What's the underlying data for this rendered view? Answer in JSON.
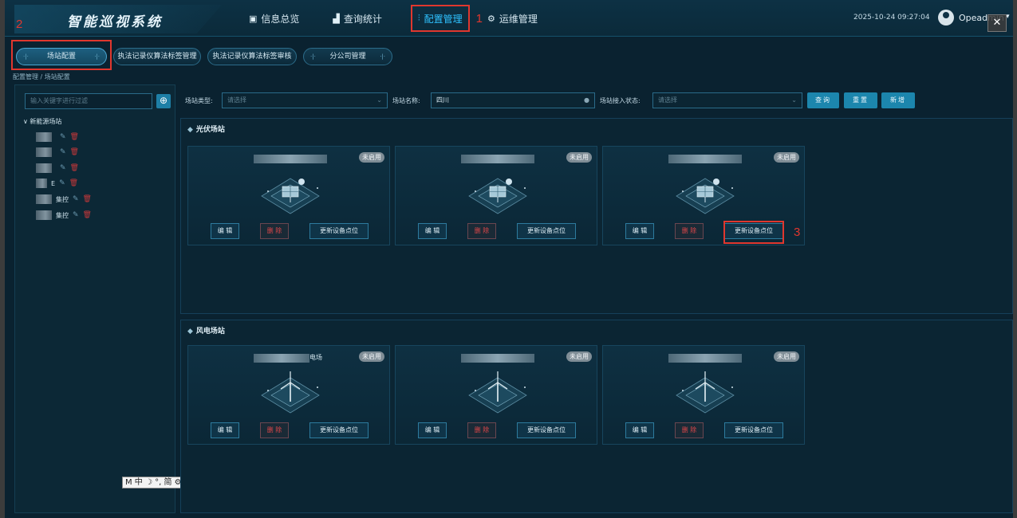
{
  "header": {
    "app_title": "智能巡视系统",
    "nav": [
      {
        "label": "信息总览",
        "icon": "monitor-icon"
      },
      {
        "label": "查询统计",
        "icon": "bar-chart-icon"
      },
      {
        "label": "配置管理",
        "icon": "sliders-icon"
      },
      {
        "label": "运维管理",
        "icon": "gears-icon"
      }
    ],
    "datetime": "2025-10-24 09:27:04",
    "username": "Opeadmin",
    "close_glyph": "✕"
  },
  "annotations": {
    "a1": "1",
    "a2": "2",
    "a3": "3"
  },
  "subtabs": [
    "场站配置",
    "执法记录仪算法标签管理",
    "执法记录仪算法标签审核",
    "分公司管理"
  ],
  "breadcrumb": "配置管理 / 场站配置",
  "tree": {
    "search_placeholder": "输入关键字进行过滤",
    "add_glyph": "⊕",
    "root": "∨ 新能源场站",
    "nodes": [
      {
        "suffix": ""
      },
      {
        "suffix": ""
      },
      {
        "suffix": ""
      },
      {
        "suffix": "E"
      },
      {
        "suffix": "集控"
      },
      {
        "suffix": "集控"
      }
    ]
  },
  "filters": {
    "type_label": "场站类型:",
    "type_placeholder": "请选择",
    "name_label": "场站名称:",
    "name_value": "四川",
    "status_label": "场站接入状态:",
    "status_placeholder": "请选择",
    "query_button": "查询",
    "reset_button": "重置",
    "add_button": "新增"
  },
  "sections": [
    {
      "title": "光伏场站",
      "cards": [
        {
          "name_suffix": "",
          "status": "未启用",
          "edit": "编 辑",
          "delete": "删 除",
          "update": "更新设备点位"
        },
        {
          "name_suffix": "",
          "status": "未启用",
          "edit": "编 辑",
          "delete": "删 除",
          "update": "更新设备点位"
        },
        {
          "name_suffix": "",
          "status": "未启用",
          "edit": "编 辑",
          "delete": "删 除",
          "update": "更新设备点位"
        }
      ]
    },
    {
      "title": "风电场站",
      "cards": [
        {
          "name_suffix": "电场",
          "status": "未启用",
          "edit": "编 辑",
          "delete": "删 除",
          "update": "更新设备点位"
        },
        {
          "name_suffix": "",
          "status": "未启用",
          "edit": "编 辑",
          "delete": "删 除",
          "update": "更新设备点位"
        },
        {
          "name_suffix": "",
          "status": "未启用",
          "edit": "编 辑",
          "delete": "删 除",
          "update": "更新设备点位"
        }
      ]
    }
  ],
  "ime_toolbar": "M 中 ☽ °, 简 ⚙ ⋮"
}
